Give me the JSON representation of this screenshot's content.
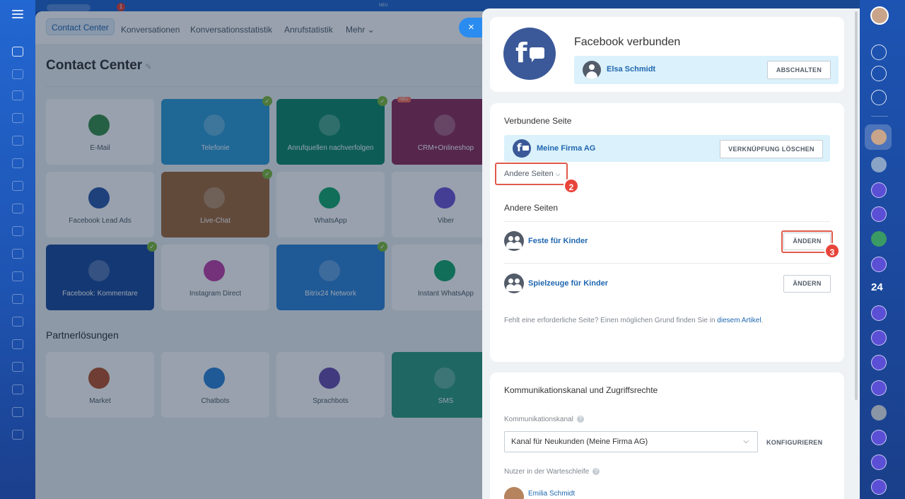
{
  "top": {
    "neu_tag": "NEU",
    "notification_count": "1"
  },
  "background": {
    "tabs": [
      "Contact Center",
      "Konversationen",
      "Konversationsstatistik",
      "Anrufstatistik",
      "Mehr ⌄"
    ],
    "title": "Contact Center",
    "tiles": [
      {
        "label": "E-Mail",
        "color": "#3b8f4a",
        "checked": false
      },
      {
        "label": "Telefonie",
        "color": "#2f9bd6",
        "checked": true
      },
      {
        "label": "Anrufquellen nachverfolgen",
        "color": "#118a6a",
        "checked": true
      },
      {
        "label": "CRM+Onlineshop",
        "color": "#8e2c5b",
        "checked": false,
        "tag": "NEU"
      },
      {
        "label": "Facebook Lead Ads",
        "color": "#2e5bab",
        "checked": false
      },
      {
        "label": "Live-Chat",
        "color": "#a26a3c",
        "checked": true
      },
      {
        "label": "WhatsApp",
        "color": "#18a86d",
        "checked": false
      },
      {
        "label": "Viber",
        "color": "#6f55d6",
        "checked": false
      },
      {
        "label": "Facebook: Kommentare",
        "color": "#1d4b9c",
        "checked": true
      },
      {
        "label": "Instagram Direct",
        "color": "#c241a8",
        "checked": false
      },
      {
        "label": "Bitrix24 Network",
        "color": "#2f84d8",
        "checked": true
      },
      {
        "label": "Instant WhatsApp",
        "color": "#18a86d",
        "checked": false
      }
    ],
    "partner_title": "Partnerlösungen",
    "partners": [
      {
        "label": "Market",
        "color": "#b9542e"
      },
      {
        "label": "Chatbots",
        "color": "#2f84d8"
      },
      {
        "label": "Sprachbots",
        "color": "#6b4fb0"
      },
      {
        "label": "SMS",
        "color": "#2f9b80"
      }
    ]
  },
  "close": {
    "icon": "×"
  },
  "connection": {
    "title": "Facebook verbunden",
    "user": "Elsa Schmidt",
    "disconnect_label": "ABSCHALTEN"
  },
  "pages": {
    "connected_title": "Verbundene Seite",
    "connected_page": "Meine Firma AG",
    "delete_link_label": "VERKNÜPFUNG LÖSCHEN",
    "other_toggle": "Andere Seiten",
    "other_title": "Andere Seiten",
    "other_pages": [
      {
        "name": "Feste für Kinder",
        "button": "ÄNDERN"
      },
      {
        "name": "Spielzeuge für Kinder",
        "button": "ÄNDERN"
      }
    ],
    "hint_text": "Fehlt eine erforderliche Seite? Einen möglichen Grund finden Sie in",
    "hint_link": "diesem Artikel",
    "hint_end": ".",
    "step2": "2",
    "step3": "3"
  },
  "channel": {
    "title": "Kommunikationskanal und Zugriffsrechte",
    "channel_label": "Kommunikationskanal",
    "channel_value": "Kanal für Neukunden (Meine Firma AG)",
    "configure_label": "KONFIGURIEREN",
    "queue_label": "Nutzer in der Warteschleife",
    "queue_user": "Emilia Schmidt"
  },
  "right_rail": {
    "counter": "24"
  }
}
